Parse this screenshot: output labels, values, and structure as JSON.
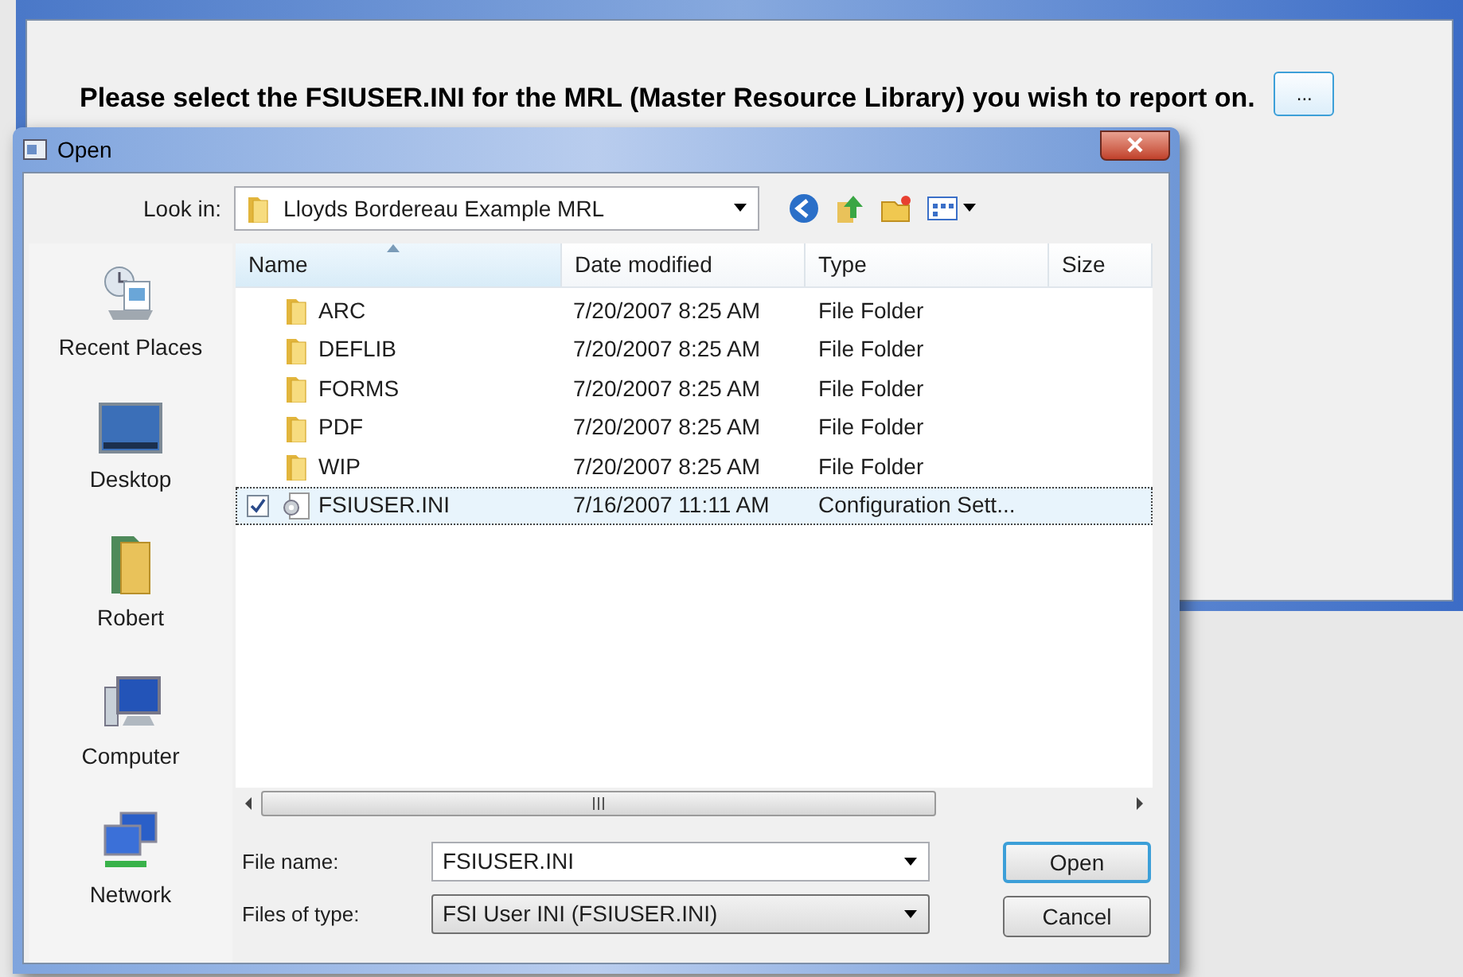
{
  "background_window": {
    "prompt": "Please select the FSIUSER.INI for the MRL (Master Resource Library) you wish to report on.",
    "browse_button": "..."
  },
  "dialog": {
    "title": "Open",
    "look_in": {
      "label": "Look in:",
      "value": "Lloyds Bordereau Example MRL"
    },
    "places": [
      {
        "label": "Recent Places",
        "kind": "recent"
      },
      {
        "label": "Desktop",
        "kind": "desktop"
      },
      {
        "label": "Robert",
        "kind": "user"
      },
      {
        "label": "Computer",
        "kind": "computer"
      },
      {
        "label": "Network",
        "kind": "network"
      }
    ],
    "columns": [
      {
        "label": "Name",
        "sorted": true
      },
      {
        "label": "Date modified",
        "sorted": false
      },
      {
        "label": "Type",
        "sorted": false
      },
      {
        "label": "Size",
        "sorted": false
      }
    ],
    "files": [
      {
        "name": "ARC",
        "date": "7/20/2007 8:25 AM",
        "type": "File Folder",
        "kind": "folder",
        "selected": false,
        "checked": false
      },
      {
        "name": "DEFLIB",
        "date": "7/20/2007 8:25 AM",
        "type": "File Folder",
        "kind": "folder",
        "selected": false,
        "checked": false
      },
      {
        "name": "FORMS",
        "date": "7/20/2007 8:25 AM",
        "type": "File Folder",
        "kind": "folder",
        "selected": false,
        "checked": false
      },
      {
        "name": "PDF",
        "date": "7/20/2007 8:25 AM",
        "type": "File Folder",
        "kind": "folder",
        "selected": false,
        "checked": false
      },
      {
        "name": "WIP",
        "date": "7/20/2007 8:25 AM",
        "type": "File Folder",
        "kind": "folder",
        "selected": false,
        "checked": false
      },
      {
        "name": "FSIUSER.INI",
        "date": "7/16/2007 11:11 AM",
        "type": "Configuration Sett...",
        "kind": "settings",
        "selected": true,
        "checked": true
      }
    ],
    "file_name": {
      "label": "File name:",
      "value": "FSIUSER.INI"
    },
    "file_type": {
      "label": "Files of type:",
      "value": "FSI User INI (FSIUSER.INI)"
    },
    "buttons": [
      {
        "label": "Open",
        "default": true
      },
      {
        "label": "Cancel",
        "default": false
      }
    ]
  }
}
